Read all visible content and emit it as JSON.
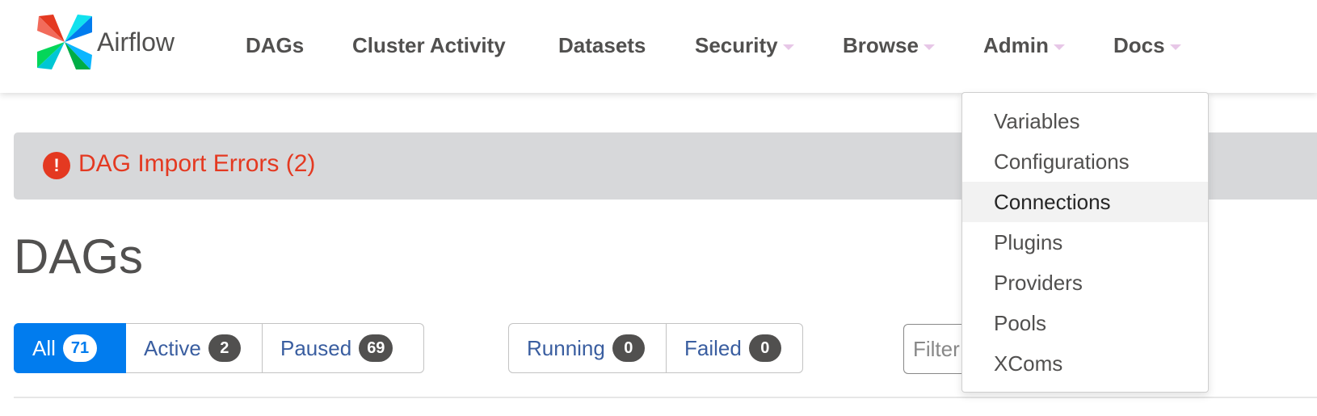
{
  "brand": {
    "name": "Airflow",
    "logo_icon": "airflow-pinwheel-logo"
  },
  "nav": {
    "items": [
      {
        "label": "DAGs",
        "has_caret": false
      },
      {
        "label": "Cluster Activity",
        "has_caret": false
      },
      {
        "label": "Datasets",
        "has_caret": false
      },
      {
        "label": "Security",
        "has_caret": true
      },
      {
        "label": "Browse",
        "has_caret": true
      },
      {
        "label": "Admin",
        "has_caret": true
      },
      {
        "label": "Docs",
        "has_caret": true
      }
    ]
  },
  "alert": {
    "icon": "exclamation-circle-icon",
    "text": "DAG Import Errors (2)"
  },
  "page": {
    "title": "DAGs"
  },
  "status_filters": [
    {
      "label": "All",
      "count": "71",
      "active": true
    },
    {
      "label": "Active",
      "count": "2",
      "active": false
    },
    {
      "label": "Paused",
      "count": "69",
      "active": false
    }
  ],
  "run_filters": [
    {
      "label": "Running",
      "count": "0"
    },
    {
      "label": "Failed",
      "count": "0"
    }
  ],
  "search": {
    "placeholder": "Filter"
  },
  "admin_menu": {
    "items": [
      "Variables",
      "Configurations",
      "Connections",
      "Plugins",
      "Providers",
      "Pools",
      "XComs"
    ],
    "hovered": "Connections"
  },
  "colors": {
    "accent": "#017cee",
    "error": "#e43921",
    "nav_text": "#51504f",
    "alert_bg": "#d7d8da"
  }
}
